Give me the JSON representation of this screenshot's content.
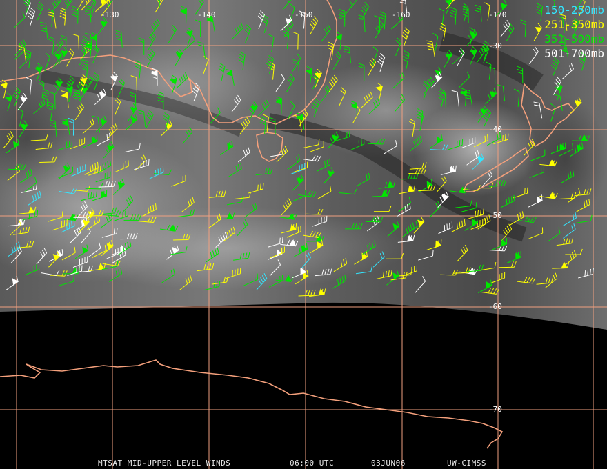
{
  "legend": [
    {
      "label": "150-250mb",
      "color": "#33e6ff"
    },
    {
      "label": "251-350mb",
      "color": "#ffff00"
    },
    {
      "label": "351-500mb",
      "color": "#00e600"
    },
    {
      "label": "501-700mb",
      "color": "#ffffff"
    }
  ],
  "longitude_labels": [
    "-130",
    "-140",
    "-150",
    "-160",
    "-170"
  ],
  "latitude_labels": [
    "-30",
    "-40",
    "-50",
    "-60",
    "-70"
  ],
  "caption": {
    "product": "MTSAT MID-UPPER LEVEL WINDS",
    "time": "06:00 UTC",
    "date": "03JUN06",
    "source": "UW-CIMSS"
  },
  "colors": {
    "grid": "#f0a080",
    "coast": "#f4a07c",
    "satellite_background": "#6a6a6a",
    "space": "#000000"
  }
}
